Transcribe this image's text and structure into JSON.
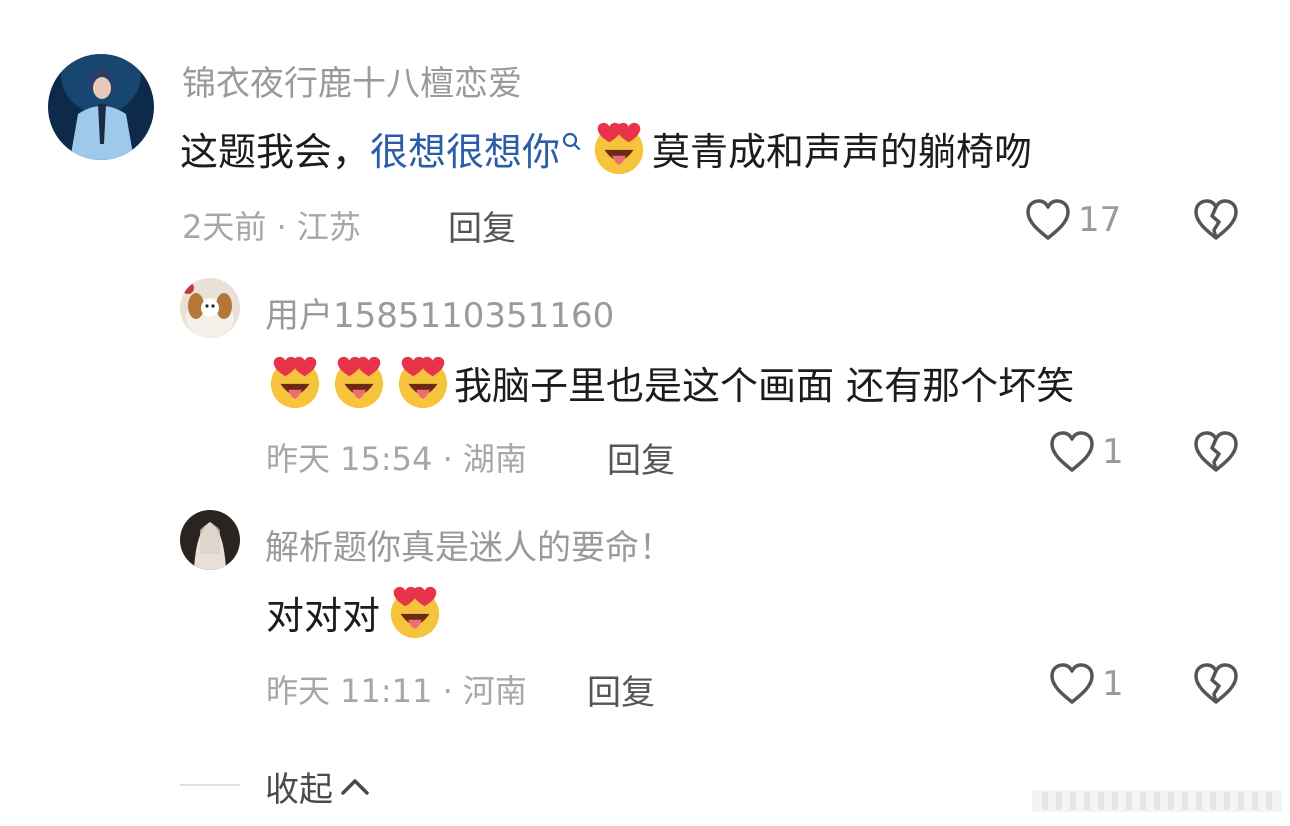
{
  "comments": [
    {
      "username": "锦衣夜行鹿十八檀恋爱",
      "text_prefix": "这题我会，",
      "link_text": "很想很想你",
      "text_suffix": "莫青成和声声的躺椅吻",
      "meta": "2天前 · 江苏",
      "reply_label": "回复",
      "like_count": "17"
    },
    {
      "username": "用户1585110351160",
      "text": "我脑子里也是这个画面 还有那个坏笑",
      "meta": "昨天 15:54 · 湖南",
      "reply_label": "回复",
      "like_count": "1"
    },
    {
      "username": "解析题你真是迷人的要命！",
      "text": "对对对",
      "meta": "昨天 11:11 · 河南",
      "reply_label": "回复",
      "like_count": "1"
    }
  ],
  "collapse_label": "收起",
  "icons": {
    "like": "heart-outline-icon",
    "dislike": "broken-heart-icon",
    "emoji": "heart-eyes-tongue-emoji",
    "search": "search-icon",
    "collapse": "chevron-up-icon"
  },
  "colors": {
    "link": "#2a5ea8",
    "username": "#9a9a9a",
    "meta": "#a7a7a7",
    "text": "#1c1c1c",
    "emoji_face": "#f6c33c",
    "emoji_heart": "#e8344a"
  }
}
